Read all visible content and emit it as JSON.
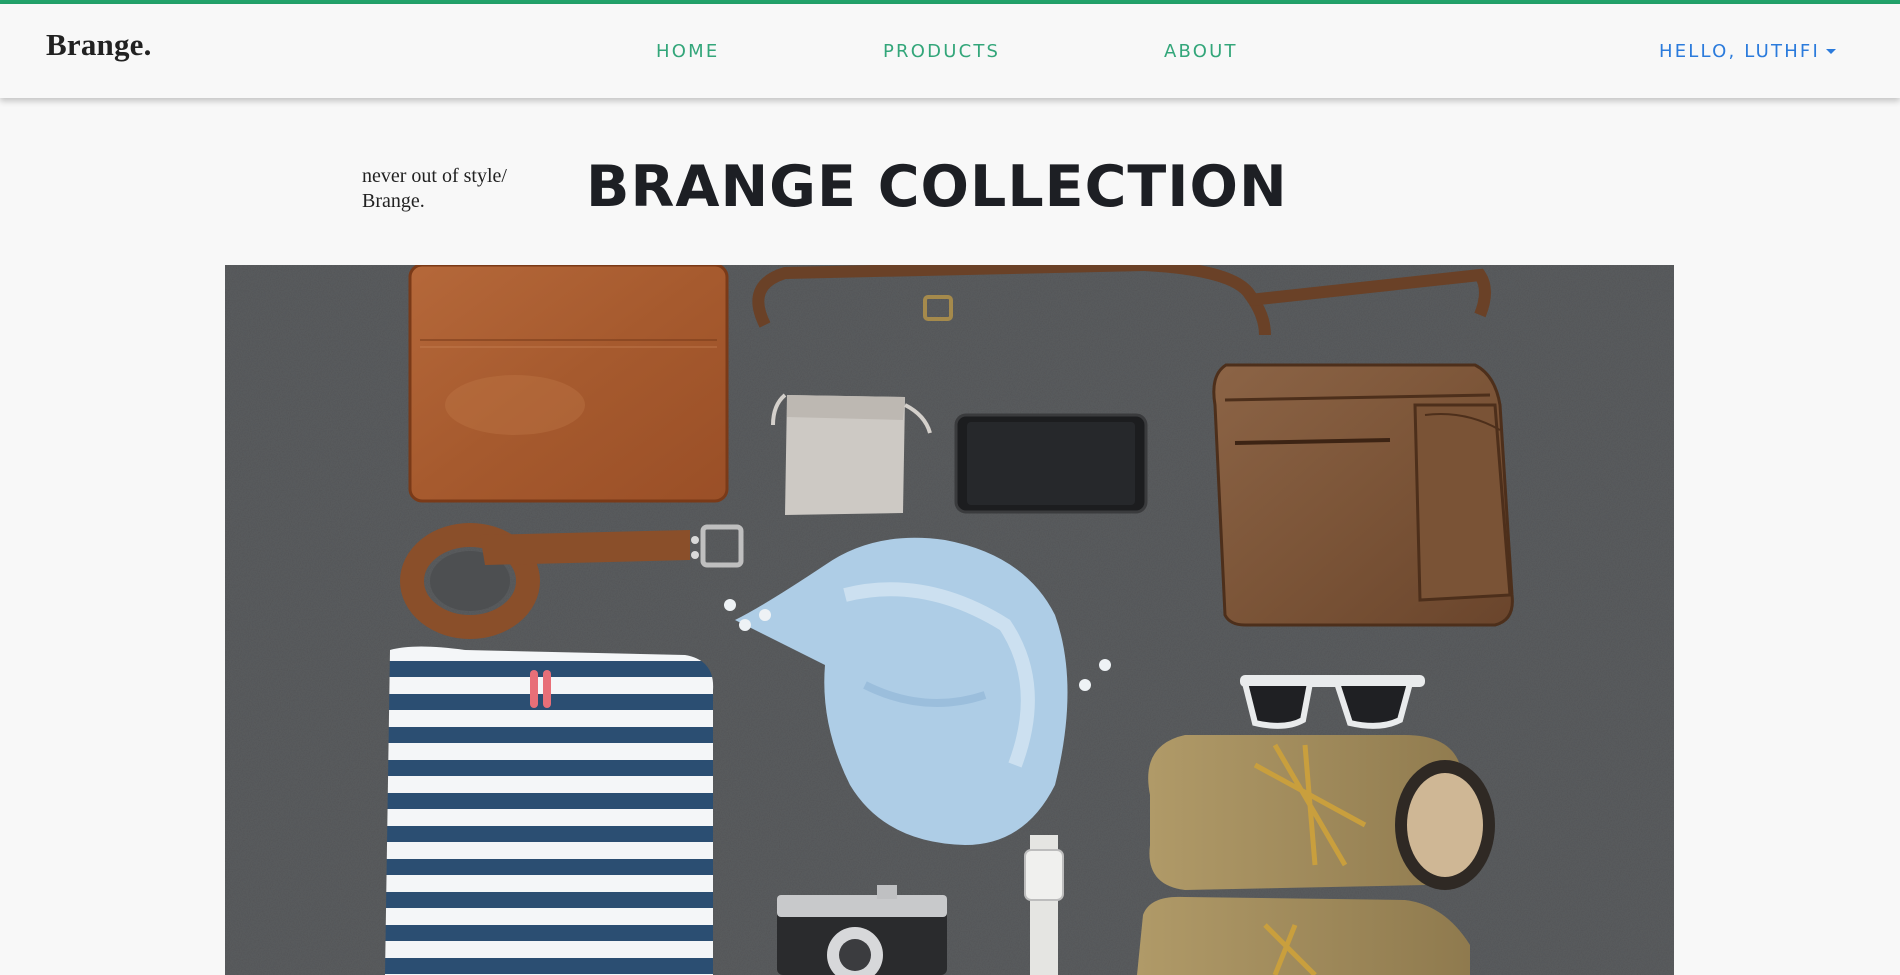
{
  "navbar": {
    "brand": "Brange.",
    "links": [
      "HOME",
      "PRODUCTS",
      "ABOUT"
    ],
    "user_menu": "HELLO, LUTHFI"
  },
  "hero": {
    "tagline_line1": "never out of style/",
    "tagline_line2": "Brange.",
    "title": "BRANGE COLLECTION"
  },
  "colors": {
    "accent_green": "#23a36b",
    "nav_link": "#33a67a",
    "user_link": "#2b7bdc",
    "title": "#1d1f24"
  },
  "icons": {
    "dropdown": "caret-down-icon"
  }
}
